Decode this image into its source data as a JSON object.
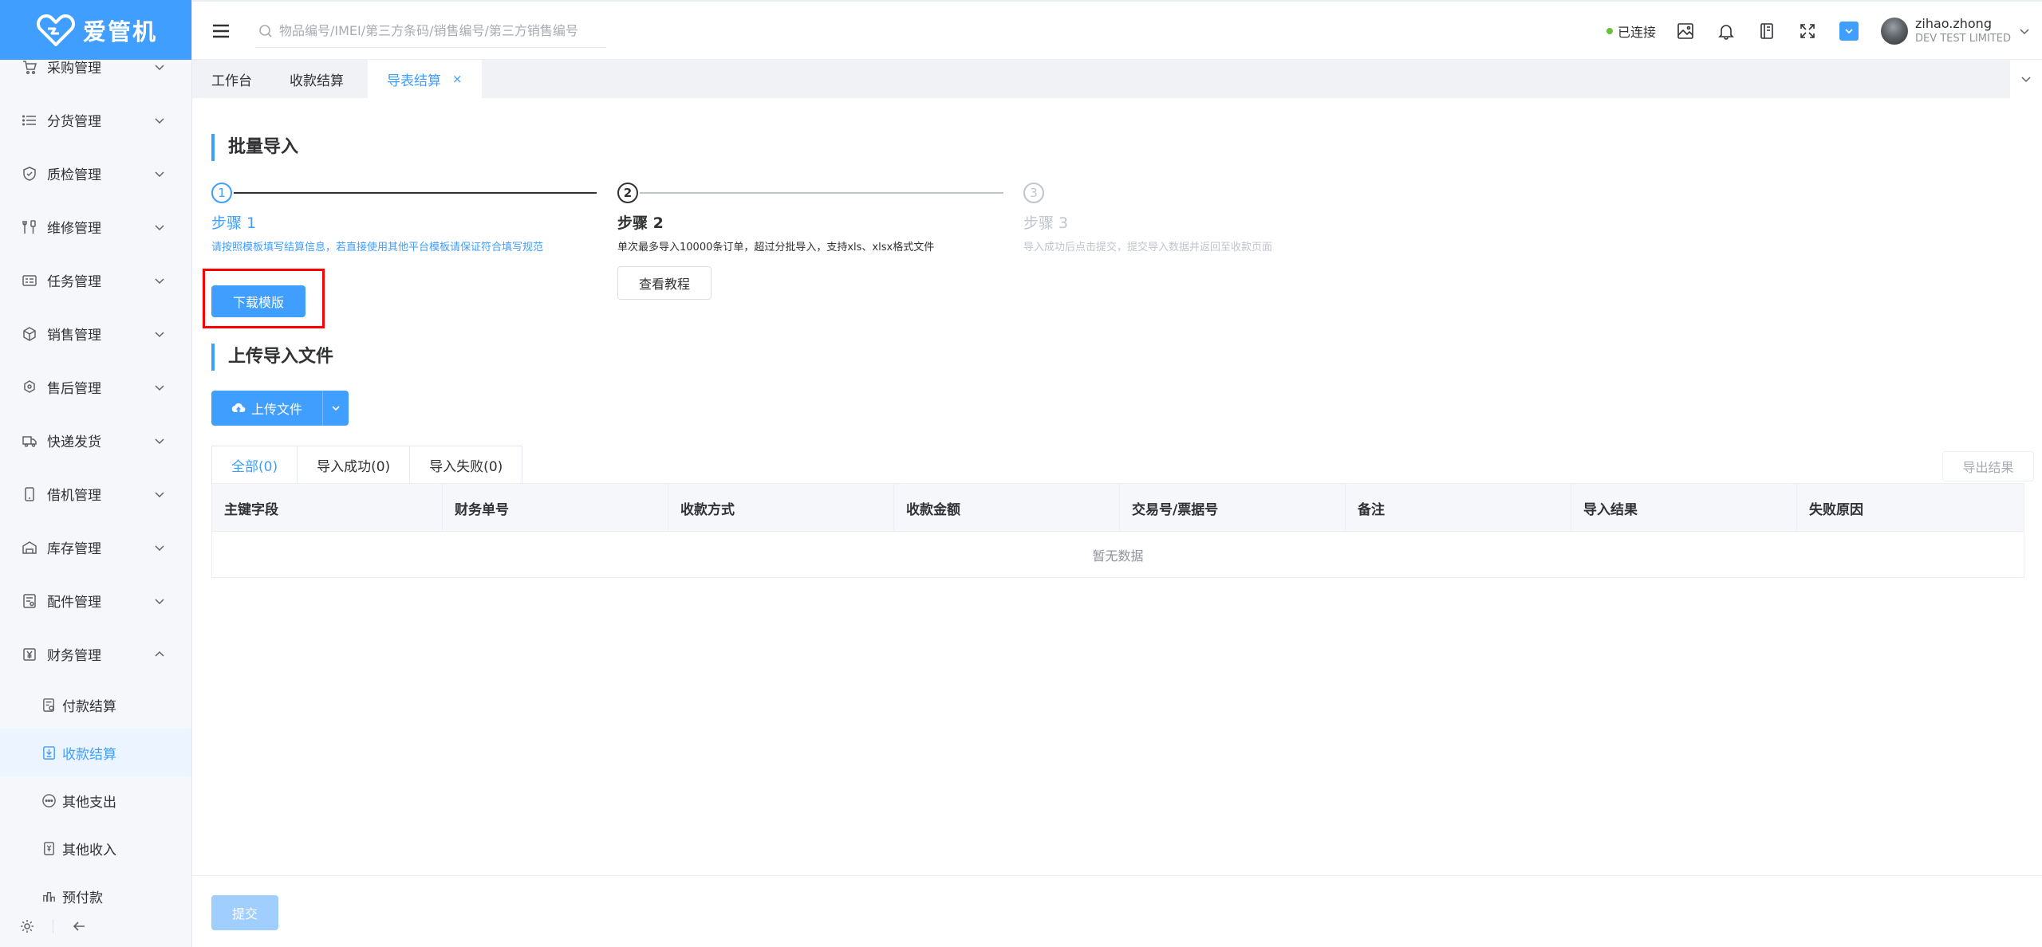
{
  "app": {
    "logo_text": "爱管机"
  },
  "sidebar": {
    "items": [
      {
        "label": "采购管理",
        "icon": "cart-icon"
      },
      {
        "label": "分货管理",
        "icon": "list-icon"
      },
      {
        "label": "质检管理",
        "icon": "shield-check-icon"
      },
      {
        "label": "维修管理",
        "icon": "tools-icon"
      },
      {
        "label": "任务管理",
        "icon": "task-card-icon"
      },
      {
        "label": "销售管理",
        "icon": "box-icon"
      },
      {
        "label": "售后管理",
        "icon": "badge-icon"
      },
      {
        "label": "快递发货",
        "icon": "truck-icon"
      },
      {
        "label": "借机管理",
        "icon": "phone-icon"
      },
      {
        "label": "库存管理",
        "icon": "warehouse-icon"
      },
      {
        "label": "配件管理",
        "icon": "parts-icon"
      },
      {
        "label": "财务管理",
        "icon": "yen-icon",
        "expanded": true
      }
    ],
    "sub_items": [
      {
        "label": "付款结算",
        "icon": "payment-doc-icon"
      },
      {
        "label": "收款结算",
        "icon": "receipt-icon",
        "active": true
      },
      {
        "label": "其他支出",
        "icon": "ellipsis-circle-icon"
      },
      {
        "label": "其他收入",
        "icon": "income-doc-icon"
      },
      {
        "label": "预付款",
        "icon": "prepay-icon"
      }
    ]
  },
  "header": {
    "search_placeholder": "物品编号/IMEI/第三方条码/销售编号/第三方销售编号",
    "connection_status": "已连接",
    "user_name": "zihao.zhong",
    "user_org": "DEV TEST LIMITED"
  },
  "tabs": [
    {
      "label": "工作台"
    },
    {
      "label": "收款结算"
    },
    {
      "label": "导表结算",
      "active": true,
      "close": "×"
    }
  ],
  "batch_import": {
    "title": "批量导入",
    "steps": [
      {
        "num": "1",
        "title": "步骤 1",
        "desc": "请按照模板填写结算信息，若直接使用其他平台模板请保证符合填写规范",
        "button": "下载模版"
      },
      {
        "num": "2",
        "title": "步骤 2",
        "desc": "单次最多导入10000条订单，超过分批导入，支持xls、xlsx格式文件",
        "button": "查看教程"
      },
      {
        "num": "3",
        "title": "步骤 3",
        "desc": "导入成功后点击提交，提交导入数据并返回至收款页面"
      }
    ]
  },
  "upload": {
    "title": "上传导入文件",
    "button": "上传文件"
  },
  "results": {
    "tabs": [
      "全部(0)",
      "导入成功(0)",
      "导入失败(0)"
    ],
    "export_button": "导出结果",
    "columns": [
      "主键字段",
      "财务单号",
      "收款方式",
      "收款金额",
      "交易号/票据号",
      "备注",
      "导入结果",
      "失败原因"
    ],
    "empty_text": "暂无数据"
  },
  "footer": {
    "submit_button": "提交"
  },
  "colors": {
    "primary": "#409eff",
    "highlight": "#ff0000",
    "connected": "#67c23a",
    "sidebar_bg": "#f5f7fa"
  }
}
